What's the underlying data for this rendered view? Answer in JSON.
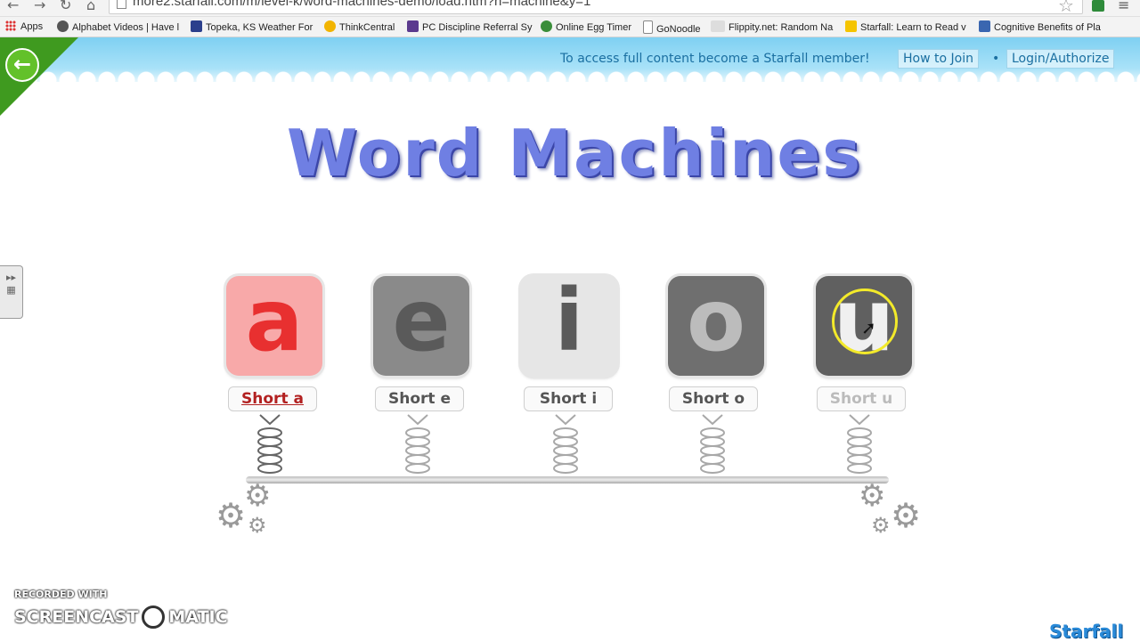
{
  "browser": {
    "url": "more2.starfall.com/m/level-k/word-machines-demo/load.htm?n=machine&y=1",
    "bookmarks": [
      {
        "label": "Apps"
      },
      {
        "label": "Alphabet Videos | Have l"
      },
      {
        "label": "Topeka, KS Weather For"
      },
      {
        "label": "ThinkCentral"
      },
      {
        "label": "PC Discipline Referral Sy"
      },
      {
        "label": "Online Egg Timer"
      },
      {
        "label": "GoNoodle"
      },
      {
        "label": "Flippity.net: Random Na"
      },
      {
        "label": "Starfall: Learn to Read v"
      },
      {
        "label": "Cognitive Benefits of Pla"
      }
    ]
  },
  "header": {
    "member_message": "To access full content become a Starfall member!",
    "how_to_join": "How to Join",
    "login": "Login/Authorize"
  },
  "title": "Word Machines",
  "tiles": [
    {
      "letter": "a",
      "label": "Short a",
      "bg": "#f8a9a9",
      "fg": "#e83030",
      "label_color": "#b22020",
      "selected": true
    },
    {
      "letter": "e",
      "label": "Short e",
      "bg": "#8a8a8a",
      "fg": "#5a5a5a",
      "label_color": "#555555"
    },
    {
      "letter": "i",
      "label": "Short i",
      "bg": "#e6e6e6",
      "fg": "#5a5a5a",
      "label_color": "#555555"
    },
    {
      "letter": "o",
      "label": "Short o",
      "bg": "#6f6f6f",
      "fg": "#bcbcbc",
      "label_color": "#555555"
    },
    {
      "letter": "u",
      "label": "Short u",
      "bg": "#606060",
      "fg": "#f0f0f0",
      "label_color": "#bbbbbb"
    }
  ],
  "watermark": {
    "recorded_with": "RECORDED WITH",
    "brand_left": "SCREENCAST",
    "brand_right": "MATIC"
  },
  "brand": "Starfall",
  "colors": {
    "header_sky": "#7fd0f2",
    "title_blue": "#6f7fe3",
    "header_text": "#1a6fa1"
  }
}
